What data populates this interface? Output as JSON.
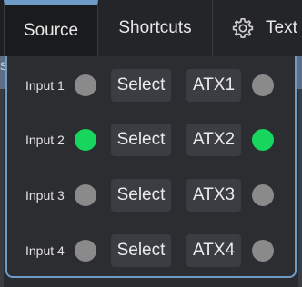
{
  "tabs": [
    {
      "label": "Source",
      "active": true
    },
    {
      "label": "Shortcuts",
      "active": false
    },
    {
      "label": "Text",
      "active": false,
      "icon": "gear-icon"
    }
  ],
  "background": {
    "partial_glyph": "s"
  },
  "colors": {
    "accent": "#6e9cc9",
    "led_on": "#17d65e",
    "led_off": "#8a8a8a"
  },
  "rows": [
    {
      "input_label": "Input 1",
      "input_active": false,
      "select_label": "Select",
      "output_label": "ATX1",
      "output_active": false
    },
    {
      "input_label": "Input 2",
      "input_active": true,
      "select_label": "Select",
      "output_label": "ATX2",
      "output_active": true
    },
    {
      "input_label": "Input 3",
      "input_active": false,
      "select_label": "Select",
      "output_label": "ATX3",
      "output_active": false
    },
    {
      "input_label": "Input 4",
      "input_active": false,
      "select_label": "Select",
      "output_label": "ATX4",
      "output_active": false
    }
  ]
}
